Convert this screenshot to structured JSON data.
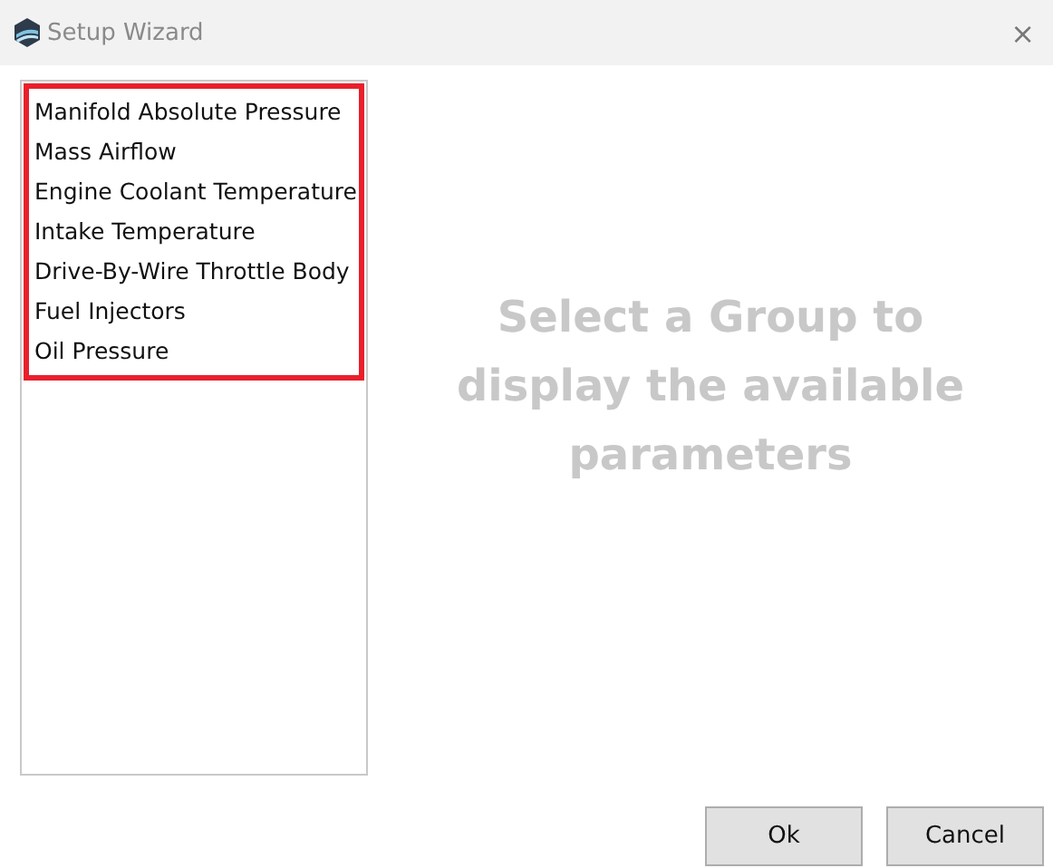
{
  "window": {
    "title": "Setup Wizard",
    "close": "×"
  },
  "groups": [
    {
      "label": "Manifold Absolute Pressure"
    },
    {
      "label": "Mass Airflow"
    },
    {
      "label": "Engine Coolant Temperature"
    },
    {
      "label": "Intake Temperature"
    },
    {
      "label": "Drive-By-Wire Throttle Body"
    },
    {
      "label": "Fuel Injectors"
    },
    {
      "label": "Oil Pressure"
    }
  ],
  "placeholder": "Select a Group to display the available parameters",
  "buttons": [
    "Ok",
    "Cancel"
  ]
}
